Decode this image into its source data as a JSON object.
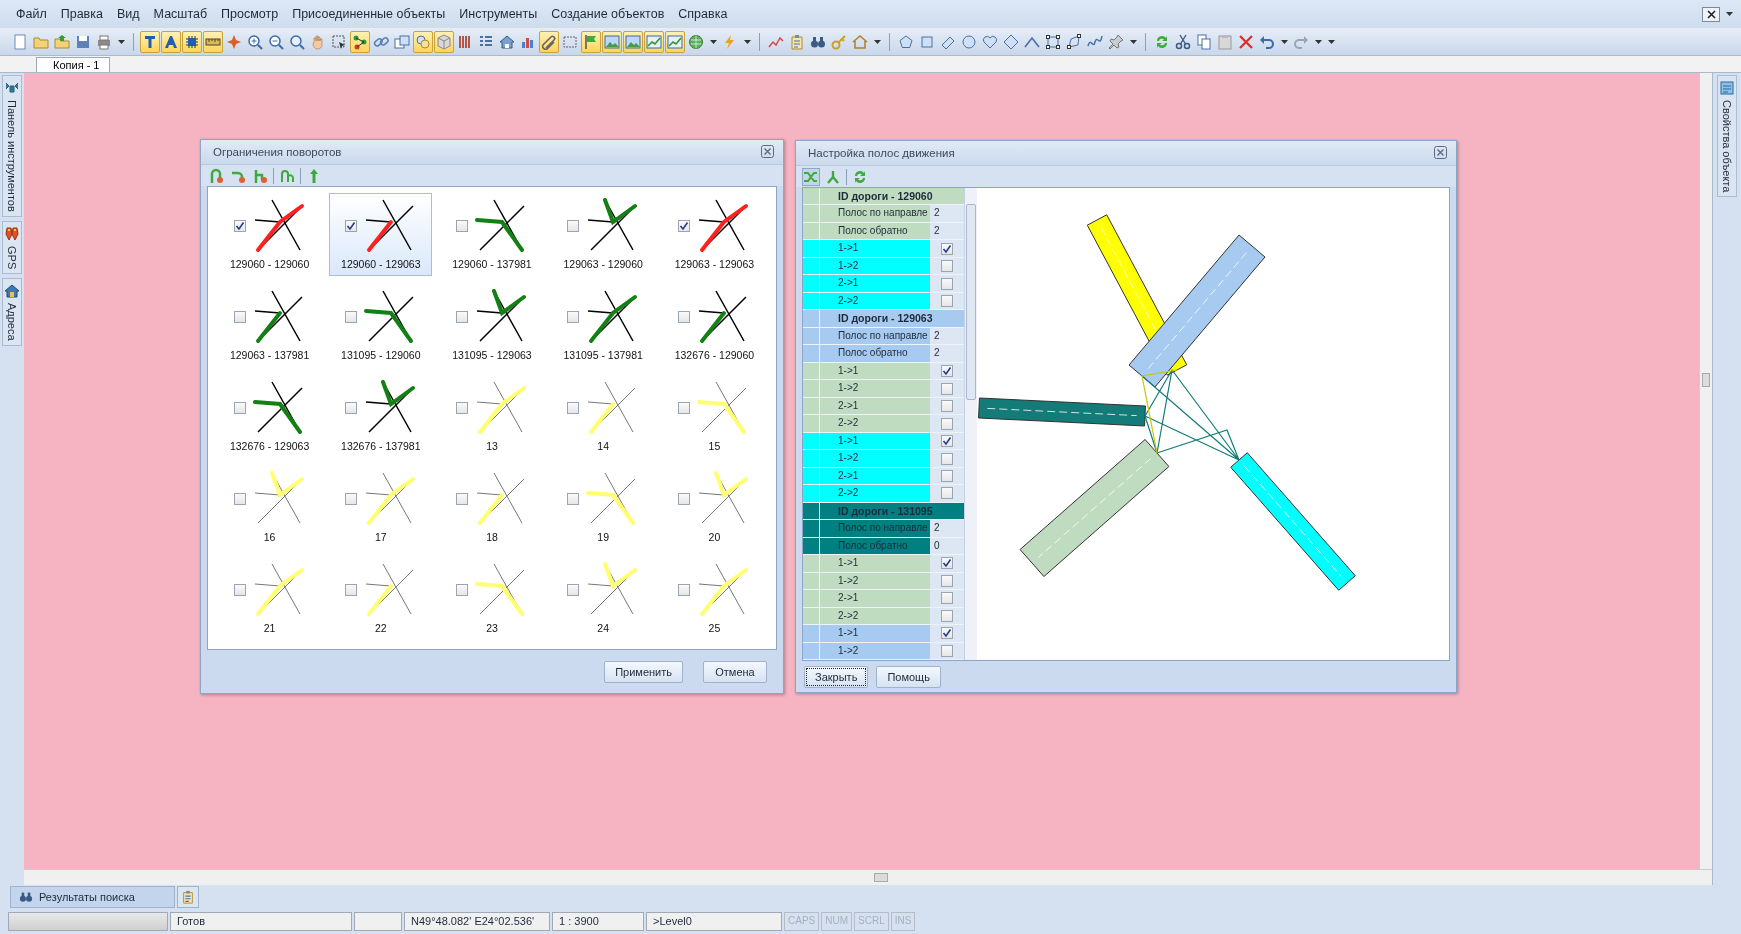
{
  "menu": [
    "Файл",
    "Правка",
    "Вид",
    "Масштаб",
    "Просмотр",
    "Присоединенные объекты",
    "Инструменты",
    "Создание объектов",
    "Справка"
  ],
  "toolbar": [
    {
      "kind": "button",
      "pressed": false
    },
    {
      "kind": "button",
      "pressed": false
    },
    {
      "kind": "button",
      "pressed": false
    },
    {
      "kind": "button",
      "pressed": false
    },
    {
      "kind": "button",
      "pressed": false
    },
    {
      "kind": "dropdown"
    },
    {
      "kind": "separator"
    },
    {
      "kind": "button",
      "pressed": true
    },
    {
      "kind": "button",
      "pressed": true
    },
    {
      "kind": "button",
      "pressed": true
    },
    {
      "kind": "button",
      "pressed": true
    },
    {
      "kind": "button",
      "pressed": false
    },
    {
      "kind": "button",
      "pressed": false
    },
    {
      "kind": "button",
      "pressed": false
    },
    {
      "kind": "button",
      "pressed": false
    },
    {
      "kind": "button",
      "pressed": false
    },
    {
      "kind": "button",
      "pressed": false
    },
    {
      "kind": "button",
      "pressed": true
    },
    {
      "kind": "button",
      "pressed": false
    },
    {
      "kind": "button",
      "pressed": false
    },
    {
      "kind": "button",
      "pressed": true
    },
    {
      "kind": "button",
      "pressed": true
    },
    {
      "kind": "button",
      "pressed": false
    },
    {
      "kind": "button",
      "pressed": false
    },
    {
      "kind": "button",
      "pressed": false
    },
    {
      "kind": "button",
      "pressed": false
    },
    {
      "kind": "button",
      "pressed": true
    },
    {
      "kind": "button",
      "pressed": false
    },
    {
      "kind": "button",
      "pressed": true
    },
    {
      "kind": "button",
      "pressed": true
    },
    {
      "kind": "button",
      "pressed": true
    },
    {
      "kind": "button",
      "pressed": true
    },
    {
      "kind": "button",
      "pressed": true
    },
    {
      "kind": "button",
      "pressed": false
    },
    {
      "kind": "dropdown"
    },
    {
      "kind": "button",
      "pressed": false
    },
    {
      "kind": "dropdown"
    },
    {
      "kind": "separator"
    },
    {
      "kind": "button",
      "pressed": false
    },
    {
      "kind": "button",
      "pressed": false
    },
    {
      "kind": "button",
      "pressed": false
    },
    {
      "kind": "button",
      "pressed": false
    },
    {
      "kind": "button",
      "pressed": false
    },
    {
      "kind": "dropdown"
    },
    {
      "kind": "separator"
    },
    {
      "kind": "button",
      "pressed": false
    },
    {
      "kind": "button",
      "pressed": false
    },
    {
      "kind": "button",
      "pressed": false
    },
    {
      "kind": "button",
      "pressed": false
    },
    {
      "kind": "button",
      "pressed": false
    },
    {
      "kind": "button",
      "pressed": false
    },
    {
      "kind": "button",
      "pressed": false
    },
    {
      "kind": "button",
      "pressed": false
    },
    {
      "kind": "button",
      "pressed": false
    },
    {
      "kind": "button",
      "pressed": false
    },
    {
      "kind": "button",
      "pressed": false
    },
    {
      "kind": "dropdown"
    },
    {
      "kind": "separator"
    },
    {
      "kind": "button",
      "pressed": false
    },
    {
      "kind": "button",
      "pressed": false
    },
    {
      "kind": "button",
      "pressed": false
    },
    {
      "kind": "button",
      "pressed": false
    },
    {
      "kind": "button",
      "pressed": false
    },
    {
      "kind": "button",
      "pressed": false
    },
    {
      "kind": "dropdown"
    },
    {
      "kind": "button",
      "pressed": false
    },
    {
      "kind": "dropdown"
    },
    {
      "kind": "dropdown"
    }
  ],
  "document_tab": {
    "label": "Копия - 1",
    "selected": true
  },
  "left_panel_tabs": [
    {
      "label": "Панель инструментов"
    },
    {
      "label": "GPS"
    },
    {
      "label": "Адреса"
    }
  ],
  "right_panel_tabs": [
    {
      "label": "Свойства объекта"
    }
  ],
  "turn_dialog": {
    "title": "Ограничения поворотов",
    "items": [
      {
        "label": "129060 - 129060",
        "checked": true,
        "selected": false,
        "kind": "forbidden"
      },
      {
        "label": "129060 - 129063",
        "checked": true,
        "selected": true,
        "kind": "forbidden"
      },
      {
        "label": "129060 - 137981",
        "checked": false,
        "selected": false,
        "kind": "allowed"
      },
      {
        "label": "129063 - 129060",
        "checked": false,
        "selected": false,
        "kind": "allowed"
      },
      {
        "label": "129063 - 129063",
        "checked": true,
        "selected": false,
        "kind": "forbidden"
      },
      {
        "label": "129063 - 137981",
        "checked": false,
        "selected": false,
        "kind": "allowed"
      },
      {
        "label": "131095 - 129060",
        "checked": false,
        "selected": false,
        "kind": "allowed"
      },
      {
        "label": "131095 - 129063",
        "checked": false,
        "selected": false,
        "kind": "allowed"
      },
      {
        "label": "131095 - 137981",
        "checked": false,
        "selected": false,
        "kind": "allowed"
      },
      {
        "label": "132676 - 129060",
        "checked": false,
        "selected": false,
        "kind": "allowed"
      },
      {
        "label": "132676 - 129063",
        "checked": false,
        "selected": false,
        "kind": "allowed"
      },
      {
        "label": "132676 - 137981",
        "checked": false,
        "selected": false,
        "kind": "allowed"
      },
      {
        "label": "13",
        "checked": false,
        "selected": false,
        "kind": "inactive"
      },
      {
        "label": "14",
        "checked": false,
        "selected": false,
        "kind": "inactive"
      },
      {
        "label": "15",
        "checked": false,
        "selected": false,
        "kind": "inactive"
      },
      {
        "label": "16",
        "checked": false,
        "selected": false,
        "kind": "inactive"
      },
      {
        "label": "17",
        "checked": false,
        "selected": false,
        "kind": "inactive"
      },
      {
        "label": "18",
        "checked": false,
        "selected": false,
        "kind": "inactive"
      },
      {
        "label": "19",
        "checked": false,
        "selected": false,
        "kind": "inactive"
      },
      {
        "label": "20",
        "checked": false,
        "selected": false,
        "kind": "inactive"
      },
      {
        "label": "21",
        "checked": false,
        "selected": false,
        "kind": "inactive"
      },
      {
        "label": "22",
        "checked": false,
        "selected": false,
        "kind": "inactive"
      },
      {
        "label": "23",
        "checked": false,
        "selected": false,
        "kind": "inactive"
      },
      {
        "label": "24",
        "checked": false,
        "selected": false,
        "kind": "inactive"
      },
      {
        "label": "25",
        "checked": false,
        "selected": false,
        "kind": "inactive"
      }
    ],
    "buttons": [
      "Применить",
      "Отмена"
    ]
  },
  "lane_dialog": {
    "title": "Настройка полос движения",
    "rows": [
      {
        "kind": "header",
        "label": "ID дороги - 129060",
        "color": "#c0dcc0"
      },
      {
        "kind": "count",
        "label": "Полос по направле",
        "value": "2",
        "color": "#c0dcc0"
      },
      {
        "kind": "count",
        "label": "Полос обратно",
        "value": "2",
        "color": "#c0dcc0"
      },
      {
        "kind": "lane",
        "label": "1->1",
        "checked": true,
        "color": "#00ffff"
      },
      {
        "kind": "lane",
        "label": "1->2",
        "checked": false,
        "color": "#00ffff"
      },
      {
        "kind": "lane",
        "label": "2->1",
        "checked": false,
        "color": "#00ffff"
      },
      {
        "kind": "lane",
        "label": "2->2",
        "checked": false,
        "color": "#00ffff"
      },
      {
        "kind": "header",
        "label": "ID дороги - 129063",
        "color": "#a6caf0"
      },
      {
        "kind": "count",
        "label": "Полос по направле",
        "value": "2",
        "color": "#a6caf0"
      },
      {
        "kind": "count",
        "label": "Полос обратно",
        "value": "2",
        "color": "#a6caf0"
      },
      {
        "kind": "lane",
        "label": "1->1",
        "checked": true,
        "color": "#c0dcc0"
      },
      {
        "kind": "lane",
        "label": "1->2",
        "checked": false,
        "color": "#c0dcc0"
      },
      {
        "kind": "lane",
        "label": "2->1",
        "checked": false,
        "color": "#c0dcc0"
      },
      {
        "kind": "lane",
        "label": "2->2",
        "checked": false,
        "color": "#c0dcc0"
      },
      {
        "kind": "lane",
        "label": "1->1",
        "checked": true,
        "color": "#00ffff"
      },
      {
        "kind": "lane",
        "label": "1->2",
        "checked": false,
        "color": "#00ffff"
      },
      {
        "kind": "lane",
        "label": "2->1",
        "checked": false,
        "color": "#00ffff"
      },
      {
        "kind": "lane",
        "label": "2->2",
        "checked": false,
        "color": "#00ffff"
      },
      {
        "kind": "header",
        "label": "ID дороги - 131095",
        "color": "#008080"
      },
      {
        "kind": "count",
        "label": "Полос по направле",
        "value": "2",
        "color": "#008080"
      },
      {
        "kind": "count",
        "label": "Полос обратно",
        "value": "0",
        "color": "#008080"
      },
      {
        "kind": "lane",
        "label": "1->1",
        "checked": true,
        "color": "#c0dcc0"
      },
      {
        "kind": "lane",
        "label": "1->2",
        "checked": false,
        "color": "#c0dcc0"
      },
      {
        "kind": "lane",
        "label": "2->1",
        "checked": false,
        "color": "#c0dcc0"
      },
      {
        "kind": "lane",
        "label": "2->2",
        "checked": false,
        "color": "#c0dcc0"
      },
      {
        "kind": "lane",
        "label": "1->1",
        "checked": true,
        "color": "#a6caf0"
      },
      {
        "kind": "lane",
        "label": "1->2",
        "checked": false,
        "color": "#a6caf0"
      }
    ],
    "buttons": [
      "Закрыть",
      "Помощь"
    ]
  },
  "bottom_tabs": [
    {
      "label": "Результаты поиска"
    }
  ],
  "status_bar": {
    "progress": {
      "level": 0
    },
    "message": "Готов",
    "coordinates": "N49°48.082' E24°02.536'",
    "scale": "1 : 3900",
    "level": ">Level0",
    "indicators": [
      {
        "label": "CAPS",
        "disabled": true
      },
      {
        "label": "NUM",
        "disabled": true
      },
      {
        "label": "SCRL",
        "disabled": true
      },
      {
        "label": "INS",
        "disabled": true
      }
    ]
  }
}
